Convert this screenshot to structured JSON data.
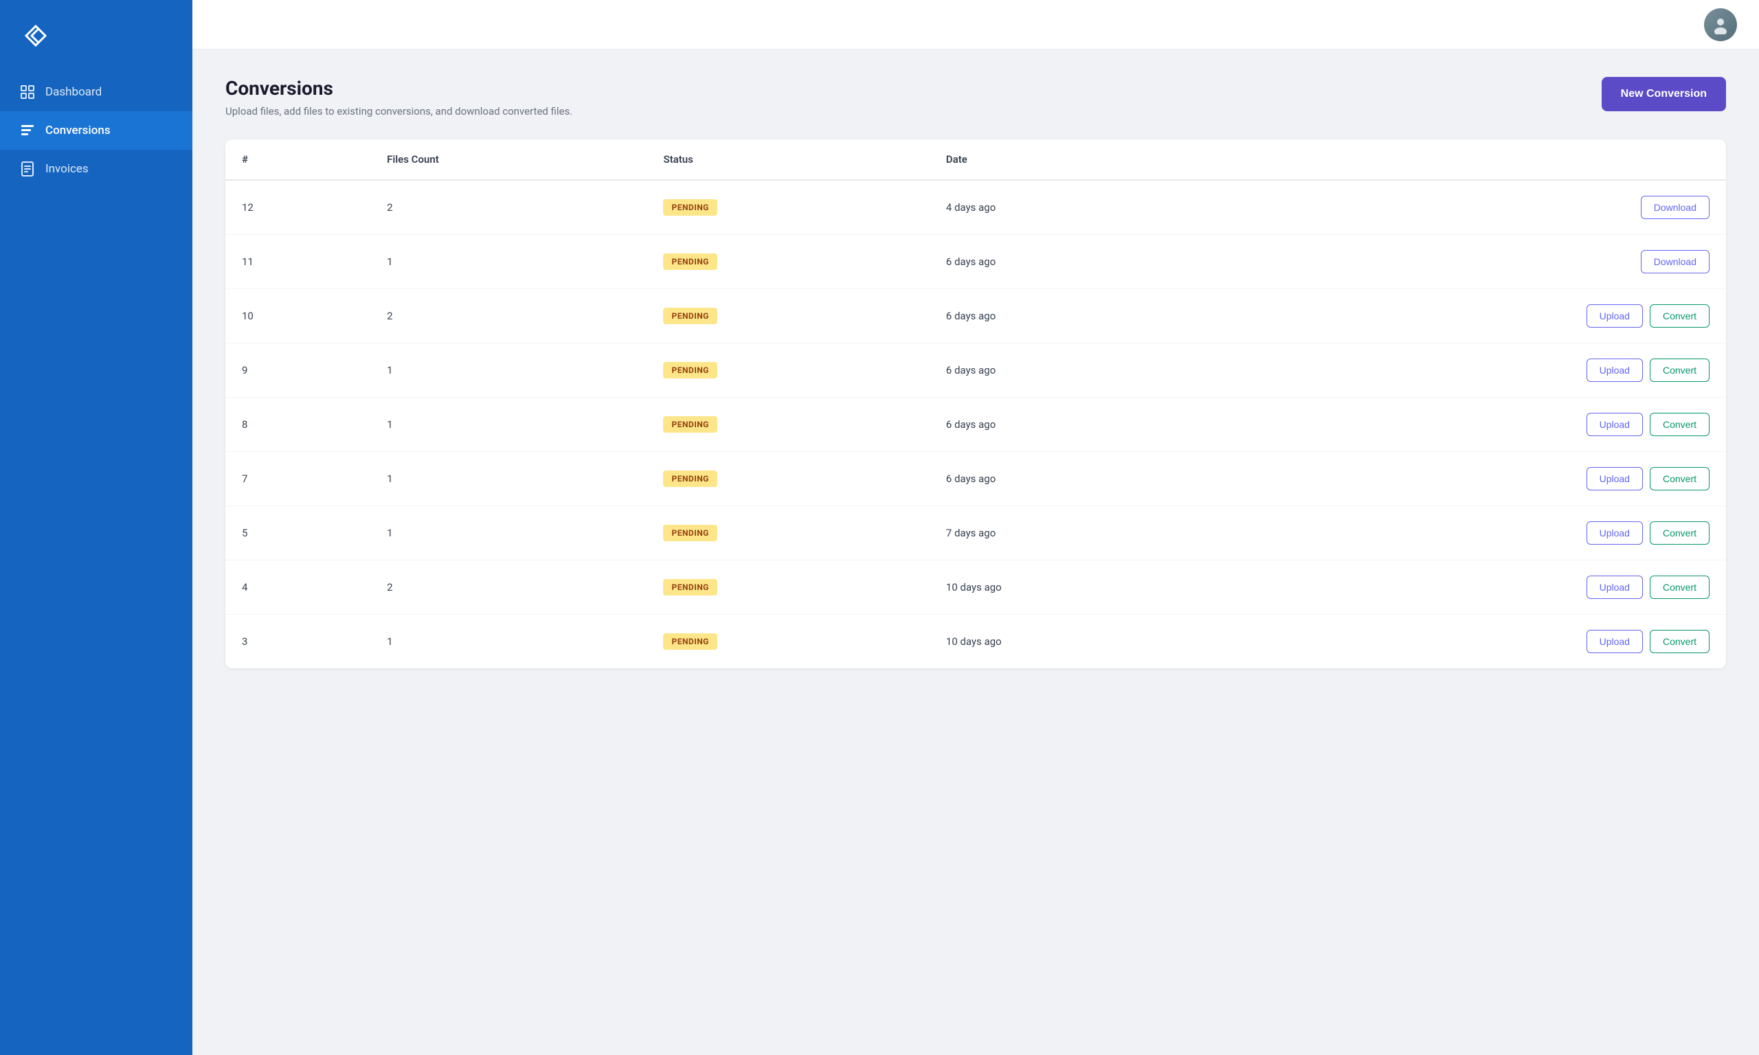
{
  "sidebar": {
    "logo_alt": "Convertr logo",
    "nav_items": [
      {
        "id": "dashboard",
        "label": "Dashboard",
        "active": false
      },
      {
        "id": "conversions",
        "label": "Conversions",
        "active": true
      },
      {
        "id": "invoices",
        "label": "Invoices",
        "active": false
      }
    ]
  },
  "header": {
    "title": "Conversions",
    "subtitle": "Upload files, add files to existing conversions, and download converted files.",
    "new_conversion_label": "New Conversion"
  },
  "table": {
    "columns": [
      "#",
      "Files Count",
      "Status",
      "Date"
    ],
    "rows": [
      {
        "id": 12,
        "files_count": 2,
        "status": "PENDING",
        "date": "4 days ago",
        "actions": [
          "Download"
        ]
      },
      {
        "id": 11,
        "files_count": 1,
        "status": "PENDING",
        "date": "6 days ago",
        "actions": [
          "Download"
        ]
      },
      {
        "id": 10,
        "files_count": 2,
        "status": "PENDING",
        "date": "6 days ago",
        "actions": [
          "Upload",
          "Convert"
        ]
      },
      {
        "id": 9,
        "files_count": 1,
        "status": "PENDING",
        "date": "6 days ago",
        "actions": [
          "Upload",
          "Convert"
        ]
      },
      {
        "id": 8,
        "files_count": 1,
        "status": "PENDING",
        "date": "6 days ago",
        "actions": [
          "Upload",
          "Convert"
        ]
      },
      {
        "id": 7,
        "files_count": 1,
        "status": "PENDING",
        "date": "6 days ago",
        "actions": [
          "Upload",
          "Convert"
        ]
      },
      {
        "id": 5,
        "files_count": 1,
        "status": "PENDING",
        "date": "7 days ago",
        "actions": [
          "Upload",
          "Convert"
        ]
      },
      {
        "id": 4,
        "files_count": 2,
        "status": "PENDING",
        "date": "10 days ago",
        "actions": [
          "Upload",
          "Convert"
        ]
      },
      {
        "id": 3,
        "files_count": 1,
        "status": "PENDING",
        "date": "10 days ago",
        "actions": [
          "Upload",
          "Convert"
        ]
      }
    ]
  },
  "status_badge_label": "PENDING",
  "avatar_initials": "👤"
}
